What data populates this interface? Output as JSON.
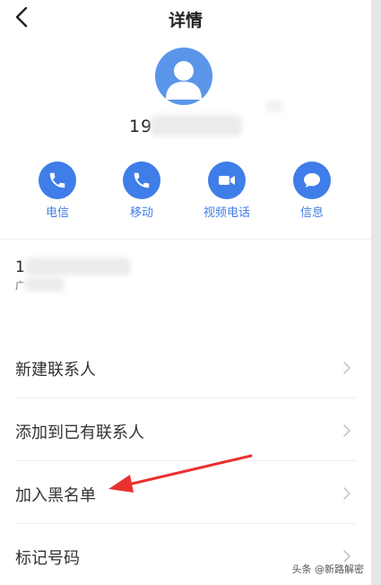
{
  "header": {
    "title": "详情"
  },
  "contact": {
    "number_visible": "19",
    "info_number_visible": "1",
    "info_location_visible": "广"
  },
  "actions": [
    {
      "label": "电信",
      "icon": "phone-icon"
    },
    {
      "label": "移动",
      "icon": "phone-icon"
    },
    {
      "label": "视频电话",
      "icon": "video-camera-icon"
    },
    {
      "label": "信息",
      "icon": "message-bubble-icon"
    }
  ],
  "menu": {
    "items": [
      {
        "label": "新建联系人"
      },
      {
        "label": "添加到已有联系人"
      },
      {
        "label": "加入黑名单"
      },
      {
        "label": "标记号码"
      }
    ]
  },
  "watermark": "头条 @新路解密",
  "colors": {
    "accent": "#3f7de8",
    "avatar": "#5b95ea",
    "annotation_arrow": "#e8322f"
  }
}
